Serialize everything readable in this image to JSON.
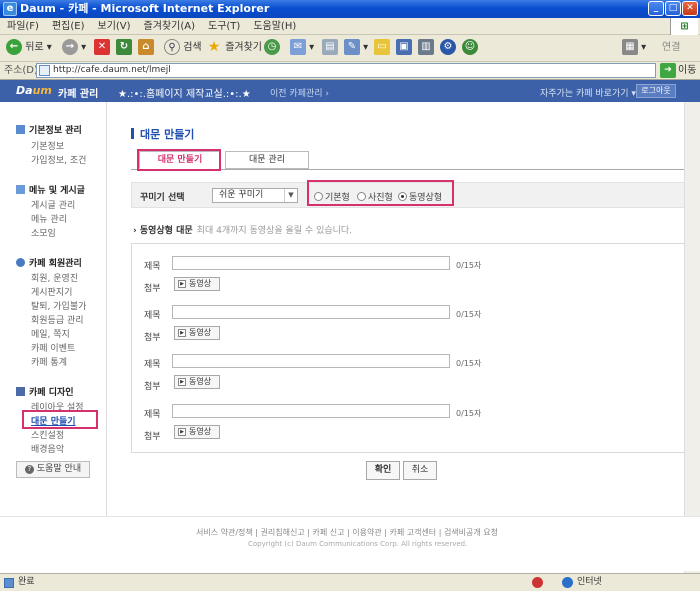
{
  "window": {
    "title": "Daum - 카페 - Microsoft Internet Explorer"
  },
  "menu": [
    "파일(F)",
    "편집(E)",
    "보기(V)",
    "즐겨찾기(A)",
    "도구(T)",
    "도움말(H)"
  ],
  "toolbar": {
    "back": "뒤로",
    "search": "검색",
    "favorites": "즐겨찾기",
    "connect": "연결"
  },
  "address": {
    "label": "주소(D)",
    "url": "http://cafe.daum.net/lmejl",
    "go": "이동"
  },
  "daumbar": {
    "logo_d": "Da",
    "logo_um": "um",
    "mgmt": "카페 관리",
    "cafe_name": "★.:•:.홈페이지 제작교실.:•:.★",
    "prev_mgmt": "이전 카페관리 ›",
    "favorites": "자주가는 카페 바로가기 ▾",
    "logout": "로그아웃"
  },
  "sidebar": {
    "basic": {
      "title": "기본정보 관리",
      "items": [
        "기본정보",
        "가입정보, 조건"
      ]
    },
    "menu": {
      "title": "메뉴 및 게시글",
      "items": [
        "게시글 관리",
        "메뉴 관리",
        "소모임"
      ]
    },
    "members": {
      "title": "카페 회원관리",
      "items": [
        "회원, 운영진",
        "게시판지기",
        "탈퇴, 가입불가",
        "회원등급 관리",
        "메일, 쪽지",
        "카페 이벤트",
        "카페 통계"
      ]
    },
    "design": {
      "title": "카페 디자인",
      "items": [
        "레이아웃 설정",
        "대문 만들기",
        "스킨설정",
        "배경음악"
      ]
    },
    "help": "도움말 안내"
  },
  "main": {
    "title": "대문 만들기",
    "tabs": [
      "대문 만들기",
      "대문 관리"
    ],
    "decor_label": "꾸미기 선택",
    "decor_select": "쉬운 꾸미기",
    "radios": [
      "기본형",
      "사진형",
      "동영상형"
    ],
    "selected_radio": "동영상형",
    "section_title": "동영상형 대문",
    "section_desc": "최대 4개까지 동영상을 올릴 수 있습니다.",
    "entries": [
      {
        "title_label": "제목",
        "count": "0/15자",
        "attach_label": "첨부",
        "button": "동영상"
      },
      {
        "title_label": "제목",
        "count": "0/15자",
        "attach_label": "첨부",
        "button": "동영상"
      },
      {
        "title_label": "제목",
        "count": "0/15자",
        "attach_label": "첨부",
        "button": "동영상"
      },
      {
        "title_label": "제목",
        "count": "0/15자",
        "attach_label": "첨부",
        "button": "동영상"
      }
    ],
    "ok": "확인",
    "cancel": "취소"
  },
  "footer": {
    "links": "서비스 약관/정책 | 권리침해신고 | 카페 신고 | 이용약관 | 카페 고객센터 | 검색비공개 요청",
    "copyright": "Copyright (c) Daum Communications Corp. All rights reserved."
  },
  "status": {
    "left": "완료",
    "zone": "인터넷"
  },
  "colors": {
    "accent": "#3c61a8",
    "highlight": "#d6306f"
  }
}
